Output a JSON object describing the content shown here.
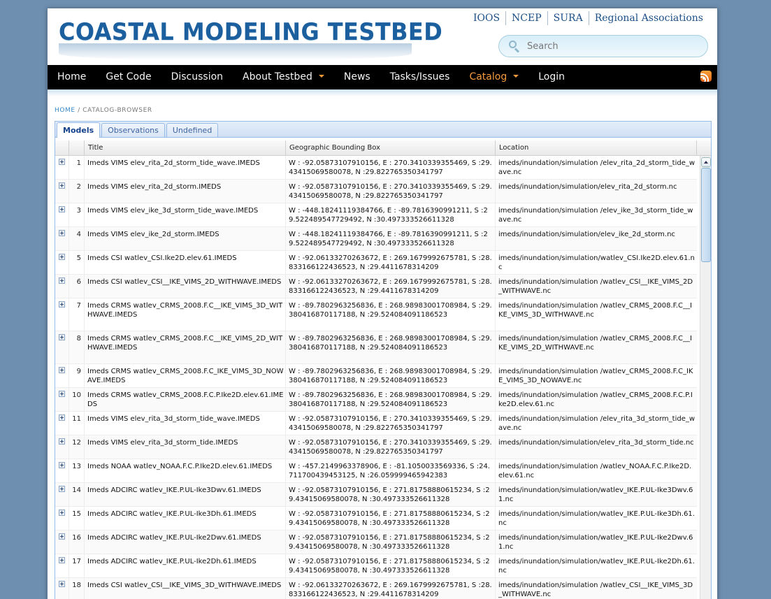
{
  "site": {
    "logo_text": "COASTAL MODELING TESTBED",
    "top_links": [
      "IOOS",
      "NCEP",
      "SURA",
      "Regional Associations"
    ],
    "search_placeholder": "Search"
  },
  "nav": {
    "items": [
      {
        "label": "Home",
        "dropdown": false,
        "active": false
      },
      {
        "label": "Get Code",
        "dropdown": false,
        "active": false
      },
      {
        "label": "Discussion",
        "dropdown": false,
        "active": false
      },
      {
        "label": "About Testbed",
        "dropdown": true,
        "active": false
      },
      {
        "label": "News",
        "dropdown": false,
        "active": false
      },
      {
        "label": "Tasks/Issues",
        "dropdown": false,
        "active": false
      },
      {
        "label": "Catalog",
        "dropdown": true,
        "active": true
      },
      {
        "label": "Login",
        "dropdown": false,
        "active": false
      }
    ],
    "rss_icon": "rss-icon"
  },
  "breadcrumb": {
    "home": "HOME",
    "separator": "/",
    "current": "CATALOG-BROWSER"
  },
  "tabs": [
    {
      "label": "Models",
      "active": true
    },
    {
      "label": "Observations",
      "active": false
    },
    {
      "label": "Undefined",
      "active": false
    }
  ],
  "grid": {
    "columns": [
      "Title",
      "Geographic Bounding Box",
      "Location"
    ],
    "rows": [
      {
        "num": "1",
        "title": "Imeds VIMS elev_rita_2d_storm_tide_wave.IMEDS",
        "bbox": "W : -92.05873107910156, E : 270.3410339355469, S :29.43415069580078, N :29.822765350341797",
        "location": "imeds/inundation/simulation /elev_rita_2d_storm_tide_wave.nc"
      },
      {
        "num": "2",
        "title": "Imeds VIMS elev_rita_2d_storm.IMEDS",
        "bbox": "W : -92.05873107910156, E : 270.3410339355469, S :29.43415069580078, N :29.822765350341797",
        "location": "imeds/inundation/simulation/elev_rita_2d_storm.nc"
      },
      {
        "num": "3",
        "title": "Imeds VIMS elev_ike_3d_storm_tide_wave.IMEDS",
        "bbox": "W : -448.18241119384766, E : -89.7816390991211, S :29.522489547729492, N :30.497333526611328",
        "location": "imeds/inundation/simulation /elev_ike_3d_storm_tide_wave.nc"
      },
      {
        "num": "4",
        "title": "Imeds VIMS elev_ike_2d_storm.IMEDS",
        "bbox": "W : -448.18241119384766, E : -89.7816390991211, S :29.522489547729492, N :30.497333526611328",
        "location": "imeds/inundation/simulation/elev_ike_2d_storm.nc"
      },
      {
        "num": "5",
        "title": "Imeds CSI watlev_CSI.Ike2D.elev.61.IMEDS",
        "bbox": "W : -92.06133270263672, E : 269.1679992675781, S :28.833166122436523, N :29.4411678314209",
        "location": "imeds/inundation/simulation/watlev_CSI.Ike2D.elev.61.nc"
      },
      {
        "num": "6",
        "title": "Imeds CSI watlev_CSI__IKE_VIMS_2D_WITHWAVE.IMEDS",
        "bbox": "W : -92.06133270263672, E : 269.1679992675781, S :28.833166122436523, N :29.4411678314209",
        "location": "imeds/inundation/simulation /watlev_CSI__IKE_VIMS_2D_WITHWAVE.nc"
      },
      {
        "num": "7",
        "title": "Imeds CRMS watlev_CRMS_2008.F.C__IKE_VIMS_3D_WITHWAVE.IMEDS",
        "bbox": "W : -89.7802963256836, E : 268.98983001708984, S :29.380416870117188, N :29.524084091186523",
        "location": "imeds/inundation/simulation /watlev_CRMS_2008.F.C__IKE_VIMS_3D_WITHWAVE.nc"
      },
      {
        "num": "8",
        "title": "Imeds CRMS watlev_CRMS_2008.F.C__IKE_VIMS_2D_WITHWAVE.IMEDS",
        "bbox": "W : -89.7802963256836, E : 268.98983001708984, S :29.380416870117188, N :29.524084091186523",
        "location": "imeds/inundation/simulation /watlev_CRMS_2008.F.C__IKE_VIMS_2D_WITHWAVE.nc"
      },
      {
        "num": "9",
        "title": "Imeds CRMS watlev_CRMS_2008.F.C_IKE_VIMS_3D_NOWAVE.IMEDS",
        "bbox": "W : -89.7802963256836, E : 268.98983001708984, S :29.380416870117188, N :29.524084091186523",
        "location": "imeds/inundation/simulation /watlev_CRMS_2008.F.C_IKE_VIMS_3D_NOWAVE.nc"
      },
      {
        "num": "10",
        "title": "Imeds CRMS watlev_CRMS_2008.F.C.P.Ike2D.elev.61.IMEDS",
        "bbox": "W : -89.7802963256836, E : 268.98983001708984, S :29.380416870117188, N :29.524084091186523",
        "location": "imeds/inundation/simulation /watlev_CRMS_2008.F.C.P.Ike2D.elev.61.nc"
      },
      {
        "num": "11",
        "title": "Imeds VIMS elev_rita_3d_storm_tide_wave.IMEDS",
        "bbox": "W : -92.05873107910156, E : 270.3410339355469, S :29.43415069580078, N :29.822765350341797",
        "location": "imeds/inundation/simulation /elev_rita_3d_storm_tide_wave.nc"
      },
      {
        "num": "12",
        "title": "Imeds VIMS elev_rita_3d_storm_tide.IMEDS",
        "bbox": "W : -92.05873107910156, E : 270.3410339355469, S :29.43415069580078, N :29.822765350341797",
        "location": "imeds/inundation/simulation/elev_rita_3d_storm_tide.nc"
      },
      {
        "num": "13",
        "title": "Imeds NOAA watlev_NOAA.F.C.P.Ike2D.elev.61.IMEDS",
        "bbox": "W : -457.2149963378906, E : -81.1050033569336, S :24.711700439453125, N :26.059999465942383",
        "location": "imeds/inundation/simulation /watlev_NOAA.F.C.P.Ike2D.elev.61.nc"
      },
      {
        "num": "14",
        "title": "Imeds ADCIRC watlev_IKE.P.UL-Ike3Dwv.61.IMEDS",
        "bbox": "W : -92.05873107910156, E : 271.81758880615234, S :29.43415069580078, N :30.497333526611328",
        "location": "imeds/inundation/simulation/watlev_IKE.P.UL-Ike3Dwv.61.nc"
      },
      {
        "num": "15",
        "title": "Imeds ADCIRC watlev_IKE.P.UL-Ike3Dh.61.IMEDS",
        "bbox": "W : -92.05873107910156, E : 271.81758880615234, S :29.43415069580078, N :30.497333526611328",
        "location": "imeds/inundation/simulation/watlev_IKE.P.UL-Ike3Dh.61.nc"
      },
      {
        "num": "16",
        "title": "Imeds ADCIRC watlev_IKE.P.UL-Ike2Dwv.61.IMEDS",
        "bbox": "W : -92.05873107910156, E : 271.81758880615234, S :29.43415069580078, N :30.497333526611328",
        "location": "imeds/inundation/simulation/watlev_IKE.P.UL-Ike2Dwv.61.nc"
      },
      {
        "num": "17",
        "title": "Imeds ADCIRC watlev_IKE.P.UL-Ike2Dh.61.IMEDS",
        "bbox": "W : -92.05873107910156, E : 271.81758880615234, S :29.43415069580078, N :30.497333526611328",
        "location": "imeds/inundation/simulation/watlev_IKE.P.UL-Ike2Dh.61.nc"
      },
      {
        "num": "18",
        "title": "Imeds CSI watlev_CSI__IKE_VIMS_3D_WITHWAVE.IMEDS",
        "bbox": "W : -92.06133270263672, E : 269.1679992675781, S :28.833166122436523, N :29.4411678314209",
        "location": "imeds/inundation/simulation /watlev_CSI__IKE_VIMS_3D_WITHWAVE.nc"
      }
    ]
  },
  "colors": {
    "background": "#6f8fb0",
    "logo": "#1b5f9e",
    "nav_bg": "#000000",
    "nav_active": "#f39a3a",
    "link": "#3a89c9",
    "tab_border": "#99bbe8"
  }
}
